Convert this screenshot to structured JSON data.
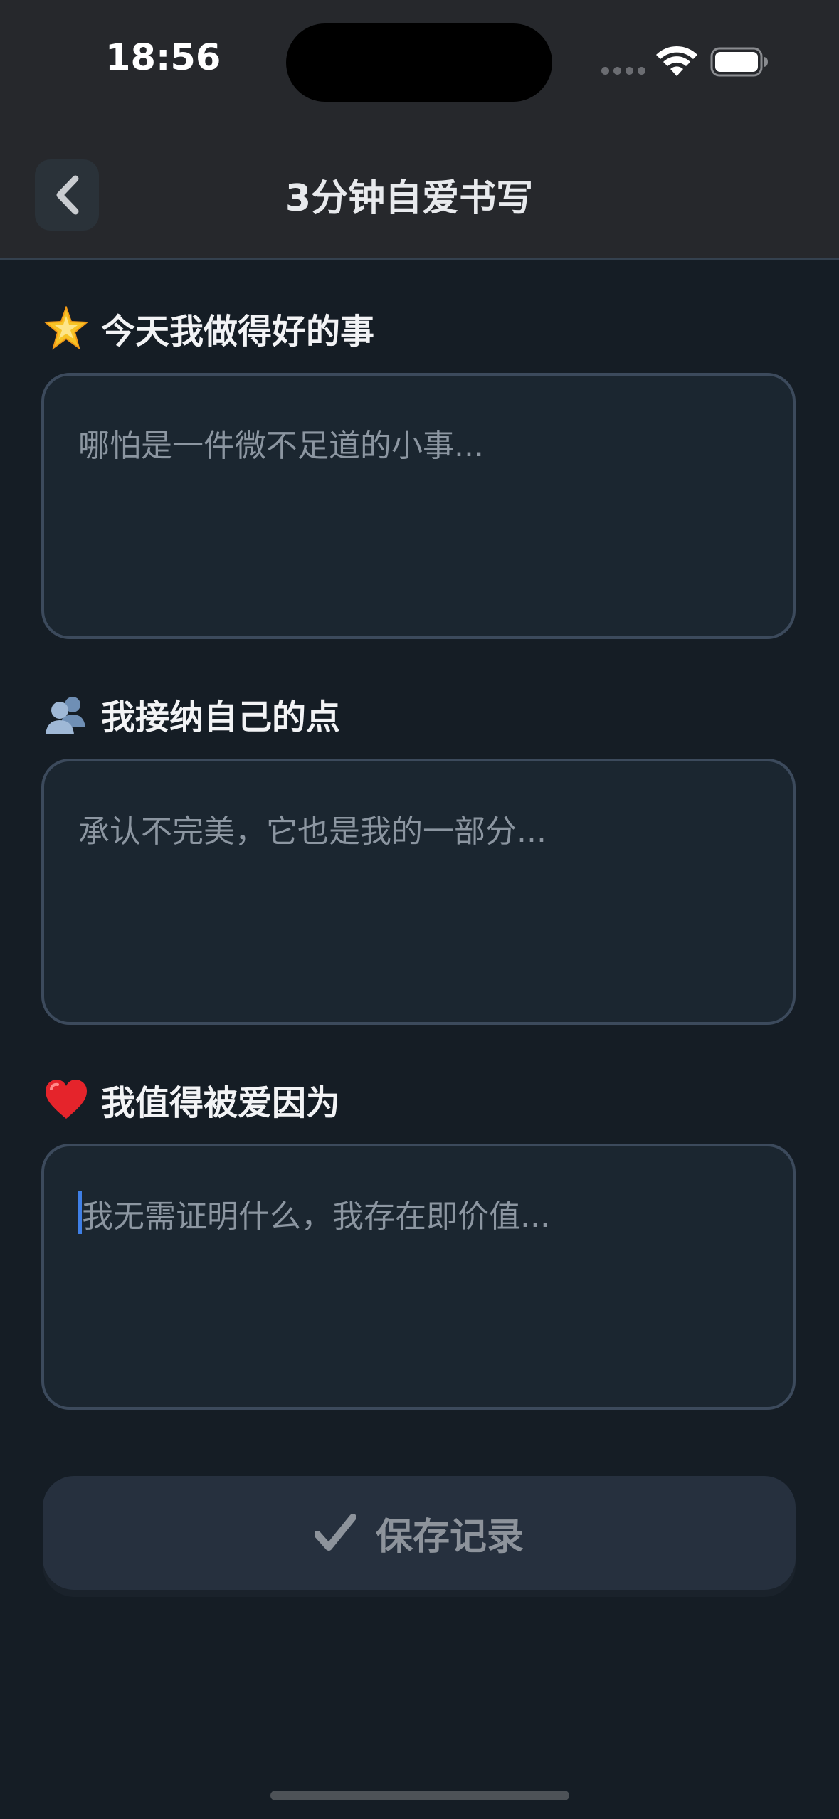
{
  "status_bar": {
    "time": "18:56"
  },
  "header": {
    "title": "3分钟自爱书写",
    "back_icon": "chevron-left-icon"
  },
  "sections": [
    {
      "emoji": "glowing-star-icon",
      "label": "今天我做得好的事",
      "placeholder": "哪怕是一件微不足道的小事..."
    },
    {
      "emoji": "busts-in-silhouette-icon",
      "label": "我接纳自己的点",
      "placeholder": "承认不完美，它也是我的一部分..."
    },
    {
      "emoji": "red-heart-icon",
      "label": "我值得被爱因为",
      "placeholder": "我无需证明什么，我存在即价值..."
    }
  ],
  "save_button": {
    "icon": "checkmark-icon",
    "label": "保存记录"
  },
  "colors": {
    "background": "#151d25",
    "header": "#26282c",
    "field": "#1b2630",
    "field_border": "#3c4a5c",
    "caret": "#3f7fe6"
  }
}
